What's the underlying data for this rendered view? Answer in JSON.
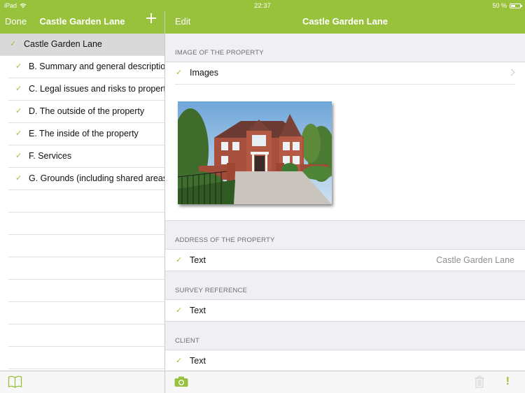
{
  "status_bar": {
    "device": "iPad",
    "time": "22:37",
    "battery": "50 %"
  },
  "master": {
    "nav": {
      "done_label": "Done",
      "title": "Castle Garden Lane"
    },
    "items": [
      {
        "label": "Castle Garden Lane",
        "selected": true
      },
      {
        "label": "B. Summary and general description"
      },
      {
        "label": "C. Legal issues and risks to property"
      },
      {
        "label": "D. The outside of the property"
      },
      {
        "label": "E. The inside of the property"
      },
      {
        "label": "F. Services"
      },
      {
        "label": "G. Grounds (including shared areas)"
      }
    ]
  },
  "detail": {
    "nav": {
      "edit_label": "Edit",
      "title": "Castle Garden Lane"
    },
    "sections": {
      "image": {
        "header": "IMAGE OF THE PROPERTY",
        "row_label": "Images"
      },
      "address": {
        "header": "ADDRESS OF THE PROPERTY",
        "row_label": "Text",
        "row_value": "Castle Garden Lane"
      },
      "survey": {
        "header": "SURVEY REFERENCE",
        "row_label": "Text"
      },
      "client": {
        "header": "CLIENT",
        "row_label": "Text"
      }
    }
  },
  "icons": {
    "check": "✓",
    "exclamation": "!"
  },
  "colors": {
    "accent": "#98c13c",
    "selected_row": "#d9d9d9",
    "secondary_text": "#8e8e93"
  }
}
